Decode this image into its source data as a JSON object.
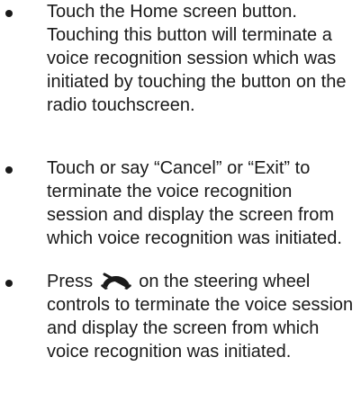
{
  "instructions": {
    "items": [
      {
        "text": "Touch the Home screen button. Touching this button will terminate a voice recognition session which was initiated by touching the button on the radio touchscreen."
      },
      {
        "text": "Touch or say “Cancel” or “Exit” to terminate the voice recognition session and display the screen from which voice recognition was initiated."
      },
      {
        "text_before_icon": "Press",
        "icon": "end-call-icon",
        "text_after_icon": "on the steering wheel controls to terminate the voice session and display the screen from which voice recognition was initiated."
      }
    ]
  }
}
